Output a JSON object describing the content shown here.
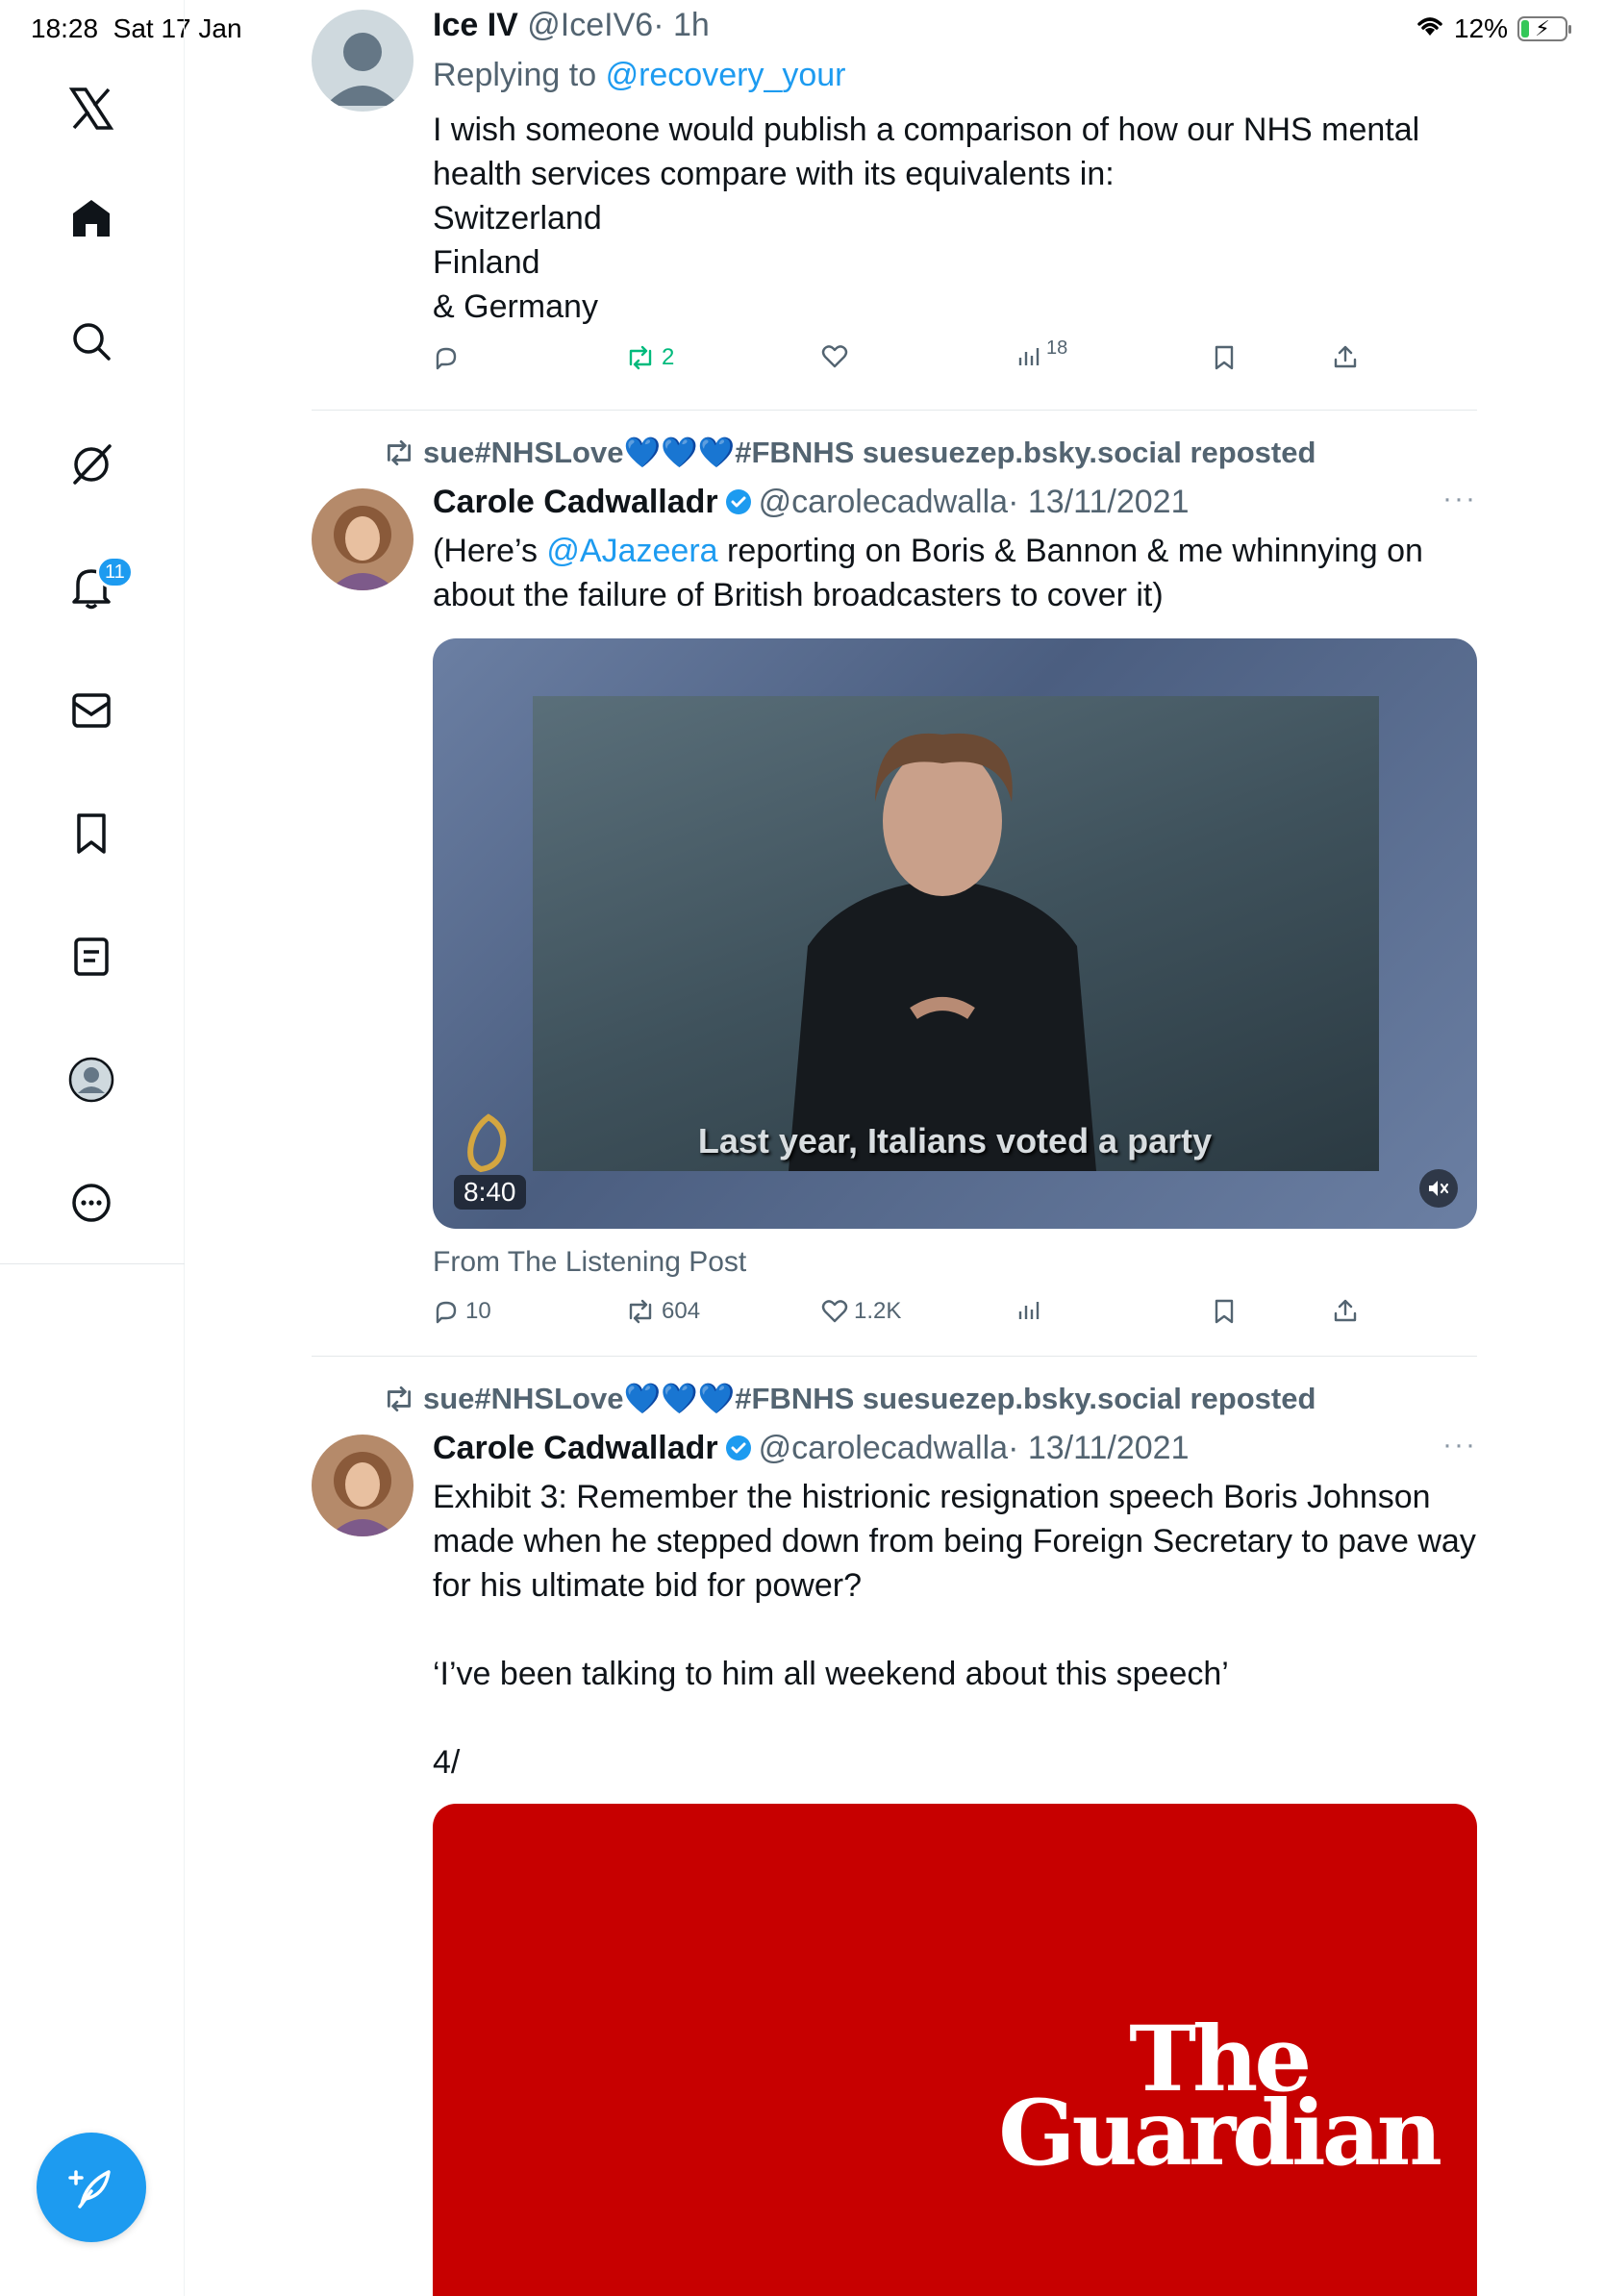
{
  "status_bar": {
    "time": "18:28",
    "date": "Sat 17 Jan",
    "battery": "12%"
  },
  "sidebar": {
    "notification_count": "11",
    "items": [
      "x-logo",
      "home",
      "search",
      "grok",
      "notifications",
      "messages",
      "bookmarks",
      "lists",
      "profile",
      "more"
    ]
  },
  "posts": [
    {
      "name": "Ice IV",
      "handle": "@IceIV6",
      "time": "· 1h",
      "replying_prefix": "Replying to",
      "replying_to": "@recovery_your",
      "lines": [
        "I wish someone would publish a comparison of how our NHS mental",
        "health services compare with its equivalents in:",
        "Switzerland",
        "Finland",
        "& Germany"
      ],
      "stats": {
        "replies": "",
        "reposts": "2",
        "likes": "",
        "views": "18"
      }
    },
    {
      "repost_by": "sue#NHSLove💙💙💙#FBNHS suesuezep.bsky.social reposted",
      "name": "Carole Cadwalladr",
      "handle": "@carolecadwalla",
      "time": "· 13/11/2021",
      "text_pre": "(Here’s ",
      "mention": "@AJazeera",
      "text_post_line1": " reporting on Boris & Bannon & me whinnying on",
      "text_line2": "about the failure of British broadcasters to cover it)",
      "video": {
        "subtitle": "Last year, Italians voted a party",
        "duration": "8:40",
        "channel": "ALJAZEERA"
      },
      "caption": "From The Listening Post",
      "stats": {
        "replies": "10",
        "reposts": "604",
        "likes": "1.2K",
        "views": ""
      }
    },
    {
      "repost_by": "sue#NHSLove💙💙💙#FBNHS suesuezep.bsky.social reposted",
      "name": "Carole Cadwalladr",
      "handle": "@carolecadwalla",
      "time": "· 13/11/2021",
      "lines": [
        "Exhibit 3: Remember the histrionic resignation speech Boris Johnson",
        "made when he stepped down from being Foreign Secretary to pave way",
        "for his ultimate bid for power?",
        "",
        "‘I’ve been talking to him all weekend about this speech’",
        "",
        "4/"
      ],
      "card": {
        "logo_line1": "The",
        "logo_line2": "Guardian"
      }
    }
  ],
  "colors": {
    "accent": "#1d9bf0",
    "repost_green": "#00ba7c",
    "secondary_text": "#536471",
    "guardian_red": "#c70000"
  }
}
